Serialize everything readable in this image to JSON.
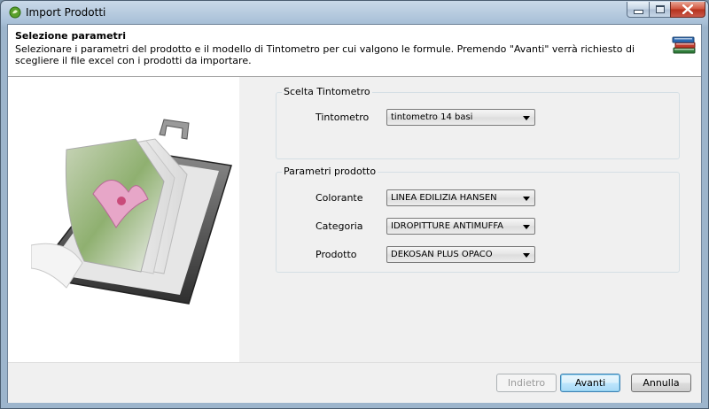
{
  "window": {
    "title": "Import Prodotti",
    "controls": {
      "minimize": "minimize",
      "maximize": "maximize",
      "close": "close"
    }
  },
  "header": {
    "title": "Selezione parametri",
    "description": "Selezionare i parametri del prodotto e il modello di Tintometro per cui valgono le formule. Premendo \"Avanti\" verrà richiesto di scegliere il file excel con i prodotti da importare."
  },
  "tintometro_group": {
    "label": "Scelta Tintometro",
    "tintometro_label": "Tintometro",
    "tintometro_value": "tintometro 14 basi"
  },
  "prodotto_group": {
    "label": "Parametri prodotto",
    "colorante_label": "Colorante",
    "colorante_value": "LINEA EDILIZIA HANSEN",
    "categoria_label": "Categoria",
    "categoria_value": "IDROPITTURE ANTIMUFFA",
    "prodotto_label": "Prodotto",
    "prodotto_value": "DEKOSAN PLUS OPACO"
  },
  "footer": {
    "back_label": "Indietro",
    "next_label": "Avanti",
    "cancel_label": "Annulla"
  },
  "icons": {
    "app": "app-icon",
    "header": "books-icon",
    "illustration": "book-illustration-icon"
  },
  "colors": {
    "accent": "#3c7fb1",
    "close": "#c9402a"
  }
}
